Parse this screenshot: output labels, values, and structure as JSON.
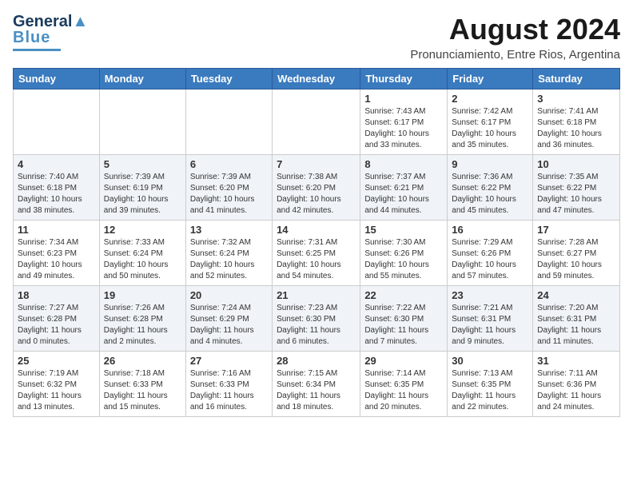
{
  "header": {
    "logo_line1": "General",
    "logo_line2": "Blue",
    "title": "August 2024",
    "subtitle": "Pronunciamiento, Entre Rios, Argentina"
  },
  "days_of_week": [
    "Sunday",
    "Monday",
    "Tuesday",
    "Wednesday",
    "Thursday",
    "Friday",
    "Saturday"
  ],
  "weeks": [
    [
      {
        "day": "",
        "info": ""
      },
      {
        "day": "",
        "info": ""
      },
      {
        "day": "",
        "info": ""
      },
      {
        "day": "",
        "info": ""
      },
      {
        "day": "1",
        "info": "Sunrise: 7:43 AM\nSunset: 6:17 PM\nDaylight: 10 hours\nand 33 minutes."
      },
      {
        "day": "2",
        "info": "Sunrise: 7:42 AM\nSunset: 6:17 PM\nDaylight: 10 hours\nand 35 minutes."
      },
      {
        "day": "3",
        "info": "Sunrise: 7:41 AM\nSunset: 6:18 PM\nDaylight: 10 hours\nand 36 minutes."
      }
    ],
    [
      {
        "day": "4",
        "info": "Sunrise: 7:40 AM\nSunset: 6:18 PM\nDaylight: 10 hours\nand 38 minutes."
      },
      {
        "day": "5",
        "info": "Sunrise: 7:39 AM\nSunset: 6:19 PM\nDaylight: 10 hours\nand 39 minutes."
      },
      {
        "day": "6",
        "info": "Sunrise: 7:39 AM\nSunset: 6:20 PM\nDaylight: 10 hours\nand 41 minutes."
      },
      {
        "day": "7",
        "info": "Sunrise: 7:38 AM\nSunset: 6:20 PM\nDaylight: 10 hours\nand 42 minutes."
      },
      {
        "day": "8",
        "info": "Sunrise: 7:37 AM\nSunset: 6:21 PM\nDaylight: 10 hours\nand 44 minutes."
      },
      {
        "day": "9",
        "info": "Sunrise: 7:36 AM\nSunset: 6:22 PM\nDaylight: 10 hours\nand 45 minutes."
      },
      {
        "day": "10",
        "info": "Sunrise: 7:35 AM\nSunset: 6:22 PM\nDaylight: 10 hours\nand 47 minutes."
      }
    ],
    [
      {
        "day": "11",
        "info": "Sunrise: 7:34 AM\nSunset: 6:23 PM\nDaylight: 10 hours\nand 49 minutes."
      },
      {
        "day": "12",
        "info": "Sunrise: 7:33 AM\nSunset: 6:24 PM\nDaylight: 10 hours\nand 50 minutes."
      },
      {
        "day": "13",
        "info": "Sunrise: 7:32 AM\nSunset: 6:24 PM\nDaylight: 10 hours\nand 52 minutes."
      },
      {
        "day": "14",
        "info": "Sunrise: 7:31 AM\nSunset: 6:25 PM\nDaylight: 10 hours\nand 54 minutes."
      },
      {
        "day": "15",
        "info": "Sunrise: 7:30 AM\nSunset: 6:26 PM\nDaylight: 10 hours\nand 55 minutes."
      },
      {
        "day": "16",
        "info": "Sunrise: 7:29 AM\nSunset: 6:26 PM\nDaylight: 10 hours\nand 57 minutes."
      },
      {
        "day": "17",
        "info": "Sunrise: 7:28 AM\nSunset: 6:27 PM\nDaylight: 10 hours\nand 59 minutes."
      }
    ],
    [
      {
        "day": "18",
        "info": "Sunrise: 7:27 AM\nSunset: 6:28 PM\nDaylight: 11 hours\nand 0 minutes."
      },
      {
        "day": "19",
        "info": "Sunrise: 7:26 AM\nSunset: 6:28 PM\nDaylight: 11 hours\nand 2 minutes."
      },
      {
        "day": "20",
        "info": "Sunrise: 7:24 AM\nSunset: 6:29 PM\nDaylight: 11 hours\nand 4 minutes."
      },
      {
        "day": "21",
        "info": "Sunrise: 7:23 AM\nSunset: 6:30 PM\nDaylight: 11 hours\nand 6 minutes."
      },
      {
        "day": "22",
        "info": "Sunrise: 7:22 AM\nSunset: 6:30 PM\nDaylight: 11 hours\nand 7 minutes."
      },
      {
        "day": "23",
        "info": "Sunrise: 7:21 AM\nSunset: 6:31 PM\nDaylight: 11 hours\nand 9 minutes."
      },
      {
        "day": "24",
        "info": "Sunrise: 7:20 AM\nSunset: 6:31 PM\nDaylight: 11 hours\nand 11 minutes."
      }
    ],
    [
      {
        "day": "25",
        "info": "Sunrise: 7:19 AM\nSunset: 6:32 PM\nDaylight: 11 hours\nand 13 minutes."
      },
      {
        "day": "26",
        "info": "Sunrise: 7:18 AM\nSunset: 6:33 PM\nDaylight: 11 hours\nand 15 minutes."
      },
      {
        "day": "27",
        "info": "Sunrise: 7:16 AM\nSunset: 6:33 PM\nDaylight: 11 hours\nand 16 minutes."
      },
      {
        "day": "28",
        "info": "Sunrise: 7:15 AM\nSunset: 6:34 PM\nDaylight: 11 hours\nand 18 minutes."
      },
      {
        "day": "29",
        "info": "Sunrise: 7:14 AM\nSunset: 6:35 PM\nDaylight: 11 hours\nand 20 minutes."
      },
      {
        "day": "30",
        "info": "Sunrise: 7:13 AM\nSunset: 6:35 PM\nDaylight: 11 hours\nand 22 minutes."
      },
      {
        "day": "31",
        "info": "Sunrise: 7:11 AM\nSunset: 6:36 PM\nDaylight: 11 hours\nand 24 minutes."
      }
    ]
  ]
}
